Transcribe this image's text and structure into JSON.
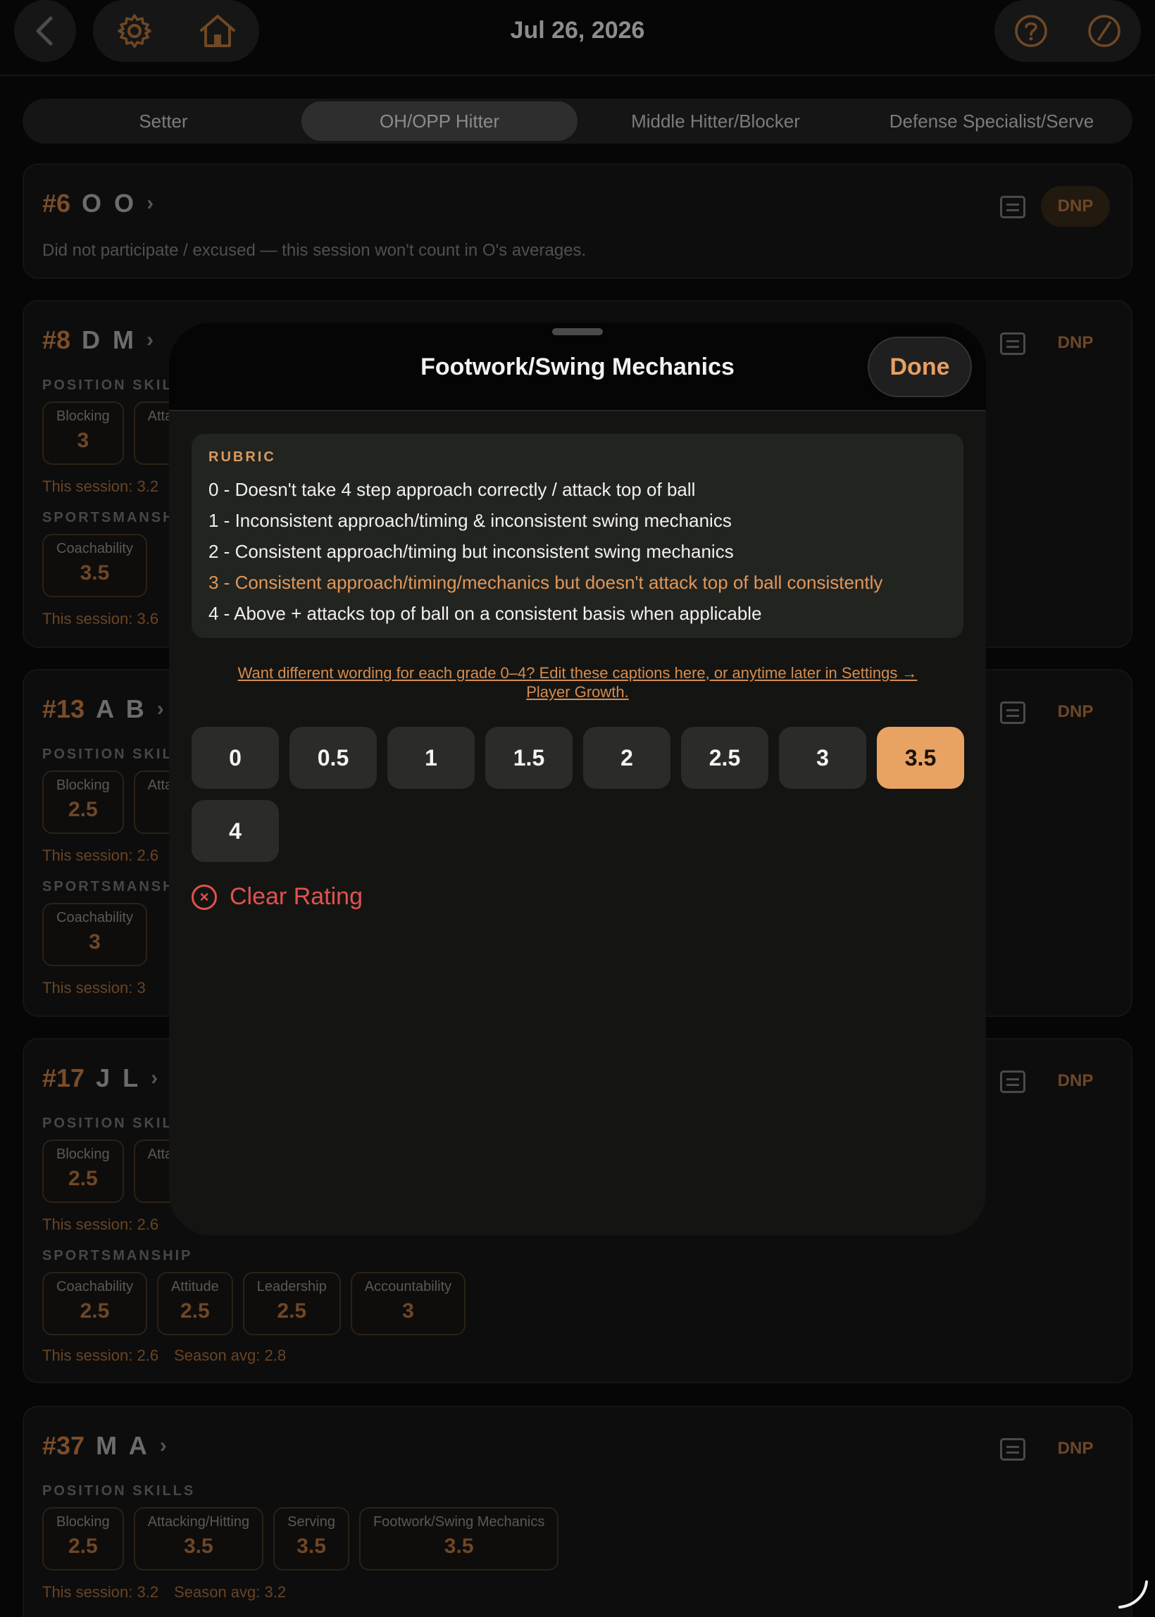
{
  "header": {
    "date": "Jul 26, 2026",
    "icons": {
      "back": "chevron-left-icon",
      "settings": "gear-icon",
      "home": "home-icon",
      "help": "question-circle-icon",
      "edit": "slash-circle-icon"
    }
  },
  "tabs": [
    {
      "label": "Setter"
    },
    {
      "label": "OH/OPP Hitter",
      "active": true
    },
    {
      "label": "Middle Hitter/Blocker"
    },
    {
      "label": "Defense Specialist/Serve"
    }
  ],
  "players": [
    {
      "number": "#6",
      "name": "O O",
      "dnp": "DNP",
      "note": "Did not participate / excused — this session won't count in O's averages."
    },
    {
      "number": "#8",
      "name": "D M",
      "dnp": "DNP",
      "position_label": "POSITION SKILLS",
      "position_skills": [
        {
          "label": "Blocking",
          "value": "3"
        },
        {
          "label": "Attacking/Hitting",
          "value": ""
        }
      ],
      "session": "This session: 3.2",
      "sports_label": "SPORTSMANSHIP",
      "sportsmanship": [
        {
          "label": "Coachability",
          "value": "3.5"
        }
      ],
      "session2": "This session: 3.6"
    },
    {
      "number": "#13",
      "name": "A B",
      "dnp": "DNP",
      "position_label": "POSITION SKILLS",
      "position_skills": [
        {
          "label": "Blocking",
          "value": "2.5"
        },
        {
          "label": "Attacking/Hitting",
          "value": ""
        }
      ],
      "session": "This session: 2.6",
      "sports_label": "SPORTSMANSHIP",
      "sportsmanship": [
        {
          "label": "Coachability",
          "value": "3"
        }
      ],
      "session2": "This session: 3"
    },
    {
      "number": "#17",
      "name": "J L",
      "dnp": "DNP",
      "position_label": "POSITION SKILLS",
      "position_skills": [
        {
          "label": "Blocking",
          "value": "2.5"
        },
        {
          "label": "Attacking/Hitting",
          "value": ""
        }
      ],
      "session": "This session: 2.6",
      "sports_label": "SPORTSMANSHIP",
      "sportsmanship": [
        {
          "label": "Coachability",
          "value": "2.5"
        },
        {
          "label": "Attitude",
          "value": "2.5"
        },
        {
          "label": "Leadership",
          "value": "2.5"
        },
        {
          "label": "Accountability",
          "value": "3"
        }
      ],
      "session2": "This session: 2.6",
      "season2": "Season avg: 2.8"
    },
    {
      "number": "#37",
      "name": "M A",
      "dnp": "DNP",
      "position_label": "POSITION SKILLS",
      "position_skills": [
        {
          "label": "Blocking",
          "value": "2.5"
        },
        {
          "label": "Attacking/Hitting",
          "value": "3.5"
        },
        {
          "label": "Serving",
          "value": "3.5"
        },
        {
          "label": "Footwork/Swing Mechanics",
          "value": "3.5"
        }
      ],
      "session": "This session: 3.2",
      "season": "Season avg: 3.2"
    }
  ],
  "modal": {
    "title": "Footwork/Swing Mechanics",
    "done_label": "Done",
    "rubric_title": "RUBRIC",
    "rubric": [
      "0 - Doesn't take 4 step approach correctly / attack top of ball",
      "1 - Inconsistent approach/timing & inconsistent swing mechanics",
      "2 - Consistent approach/timing but inconsistent swing mechanics",
      "3 - Consistent approach/timing/mechanics but doesn't attack top of ball consistently",
      "4 - Above + attacks top of ball on a consistent basis when applicable"
    ],
    "highlighted_rubric_index": 3,
    "caption_link_1": "Want different wording for each grade 0–4? Edit these captions here, or anytime later in Settings →",
    "caption_link_2": "Player Growth.",
    "grades": [
      "0",
      "0.5",
      "1",
      "1.5",
      "2",
      "2.5",
      "3",
      "3.5",
      "4"
    ],
    "selected_grade": "3.5",
    "clear_label": "Clear Rating"
  },
  "colors": {
    "accent": "#e8a363",
    "destructive": "#e0524f"
  }
}
